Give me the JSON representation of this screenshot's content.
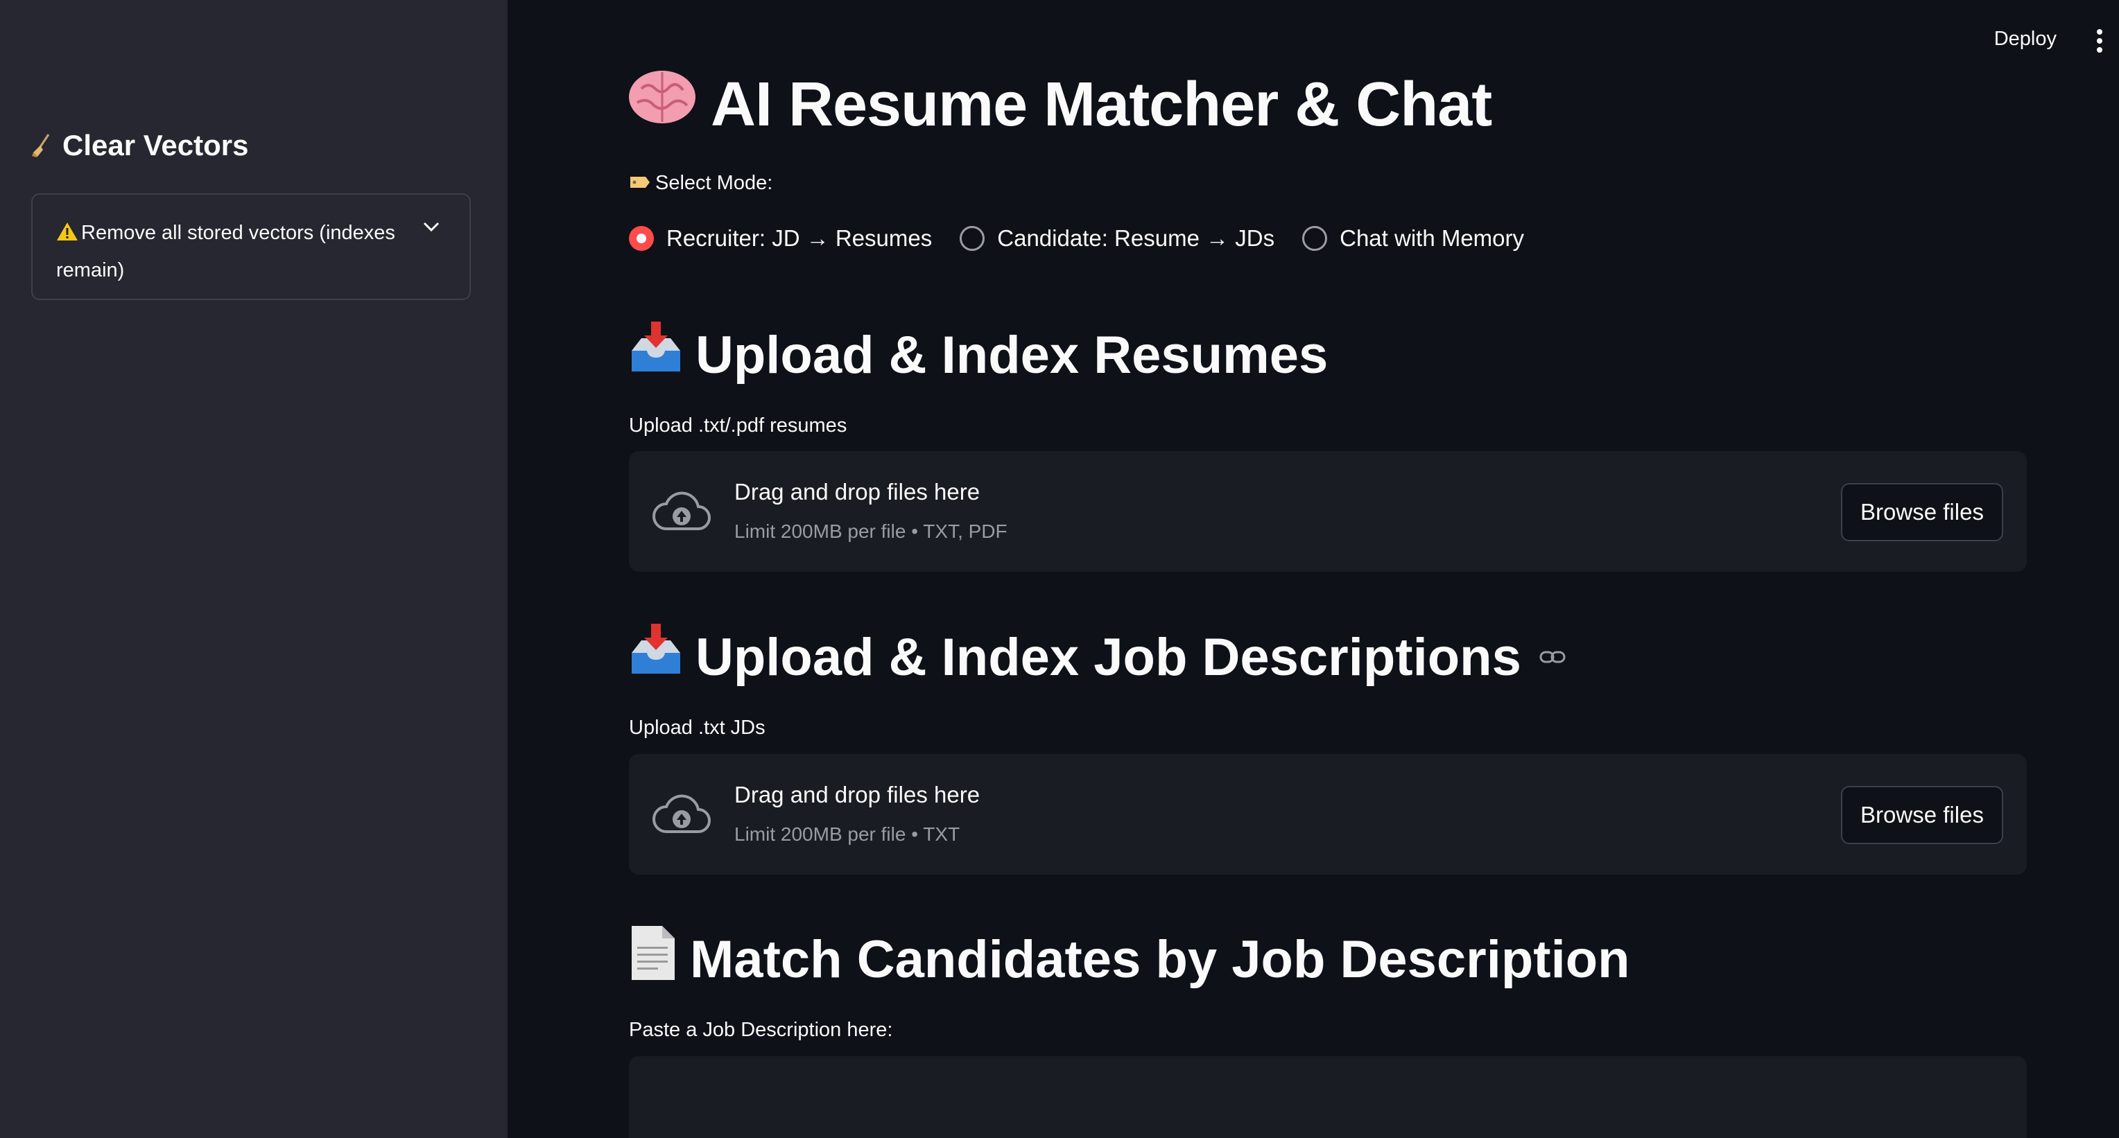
{
  "sidebar": {
    "title": "Clear Vectors",
    "expander_label": "Remove all stored vectors (indexes remain)"
  },
  "header": {
    "deploy_label": "Deploy"
  },
  "main": {
    "title": "AI Resume Matcher & Chat",
    "select_mode_label": "Select Mode:",
    "modes": [
      {
        "label": "Recruiter: JD → Resumes",
        "selected": true
      },
      {
        "label": "Candidate: Resume → JDs",
        "selected": false
      },
      {
        "label": "Chat with Memory",
        "selected": false
      }
    ],
    "sections": [
      {
        "heading": "Upload & Index Resumes",
        "uploader_label": "Upload .txt/.pdf resumes",
        "drop_title": "Drag and drop files here",
        "drop_limit": "Limit 200MB per file • TXT, PDF",
        "browse_label": "Browse files"
      },
      {
        "heading": "Upload & Index Job Descriptions",
        "uploader_label": "Upload .txt JDs",
        "drop_title": "Drag and drop files here",
        "drop_limit": "Limit 200MB per file • TXT",
        "browse_label": "Browse files"
      },
      {
        "heading": "Match Candidates by Job Description",
        "textarea_label": "Paste a Job Description here:"
      }
    ]
  },
  "colors": {
    "background": "#0e1117",
    "sidebar": "#262730",
    "accent": "#ff4b4b",
    "surface": "#1a1c24"
  }
}
